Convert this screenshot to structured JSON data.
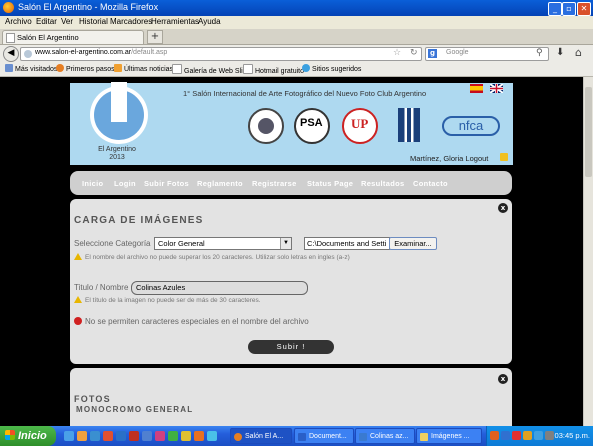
{
  "window": {
    "title": "Salón El Argentino - Mozilla Firefox"
  },
  "menu": [
    "Archivo",
    "Editar",
    "Ver",
    "Historial",
    "Marcadores",
    "Herramientas",
    "Ayuda"
  ],
  "tab": {
    "label": "Salón El Argentino",
    "new_tab": "+"
  },
  "nav": {
    "url_domain": "www.salon-el-argentino.com.ar",
    "url_path": "/default.asp",
    "search_placeholder": "Google",
    "search_engine_letter": "g"
  },
  "bookmarks": [
    "Más visitados",
    "Primeros pasos",
    "Últimas noticias",
    "Galería de Web Slice",
    "Hotmail gratuito",
    "Sitios sugeridos"
  ],
  "header": {
    "salon_title": "1° Salón Internacional de Arte Fotográfico del Nuevo Foto Club Argentino",
    "logo_name_line1": "El Argentino",
    "logo_name_line2": "2013",
    "user": "Martínez, Gloria Logout",
    "seal_psa": "PSA",
    "seal_up": "UP",
    "seal_nfca": "nfca"
  },
  "site_nav": [
    "Inicio",
    "Login",
    "Subir Fotos",
    "Reglamento",
    "Registrarse",
    "Status Page",
    "Resultados",
    "Contacto"
  ],
  "upload": {
    "title": "CARGA DE IMÁGENES",
    "category_label": "Seleccione Categoría",
    "category_value": "Color General",
    "file_value": "C:\\Documents and Setti",
    "browse_button": "Examinar...",
    "name_warning": "El nombre del archivo no puede superar los 20 caracteres. Utilizar solo letras en ingles (a-z)",
    "title_label": "Titulo / Nombre",
    "title_value": "Colinas Azules",
    "title_warning": "El título de la imagen no puede ser de más de 30 caracteres.",
    "error": "No se permiten caracteres especiales en el nombre del archivo",
    "submit": "Subir !",
    "close": "x"
  },
  "fotos": {
    "title": "FOTOS",
    "subtitle": "MONOCROMO GENERAL",
    "close": "x"
  },
  "taskbar": {
    "start": "Inicio",
    "tasks": [
      "Salón El A...",
      "Document...",
      "Colinas az...",
      "Imágenes ..."
    ],
    "clock": "03:45 p.m."
  },
  "colors": {
    "header_bg": "#aed9f0",
    "panel_bg": "#e3e3e3",
    "error": "#d02020",
    "warning": "#e8b600"
  }
}
